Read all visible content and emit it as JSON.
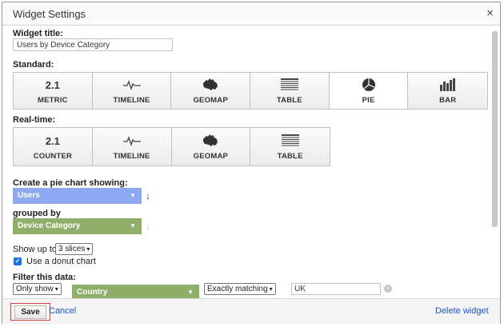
{
  "dialog": {
    "title": "Widget Settings",
    "close": "×"
  },
  "widget_title": {
    "label": "Widget title:",
    "value": "Users by Device Category"
  },
  "standard": {
    "label": "Standard:",
    "items": [
      {
        "icon_text": "2.1",
        "label": "METRIC"
      },
      {
        "icon": "timeline-icon",
        "label": "TIMELINE"
      },
      {
        "icon": "geomap-icon",
        "label": "GEOMAP"
      },
      {
        "icon": "table-icon",
        "label": "TABLE"
      },
      {
        "icon": "pie-icon",
        "label": "PIE",
        "selected": true
      },
      {
        "icon": "bar-icon",
        "label": "BAR"
      }
    ]
  },
  "realtime": {
    "label": "Real-time:",
    "items": [
      {
        "icon_text": "2.1",
        "label": "COUNTER"
      },
      {
        "icon": "timeline-icon",
        "label": "TIMELINE"
      },
      {
        "icon": "geomap-icon",
        "label": "GEOMAP"
      },
      {
        "icon": "table-icon",
        "label": "TABLE"
      }
    ]
  },
  "pie_chart": {
    "label": "Create a pie chart showing:",
    "metric": "Users",
    "metric_color": "#8ea9f2"
  },
  "grouped_by": {
    "label": "grouped by",
    "dimension": "Device Category",
    "dimension_color": "#8fae6a"
  },
  "show_up_to": {
    "label": "Show up to",
    "value": "3 slices"
  },
  "donut": {
    "label": "Use a donut chart",
    "checked": true
  },
  "filter": {
    "label": "Filter this data:",
    "mode": "Only show",
    "dimension": "Country",
    "match": "Exactly matching",
    "value": "UK"
  },
  "footer": {
    "save": "Save",
    "cancel": "Cancel",
    "delete": "Delete widget"
  }
}
